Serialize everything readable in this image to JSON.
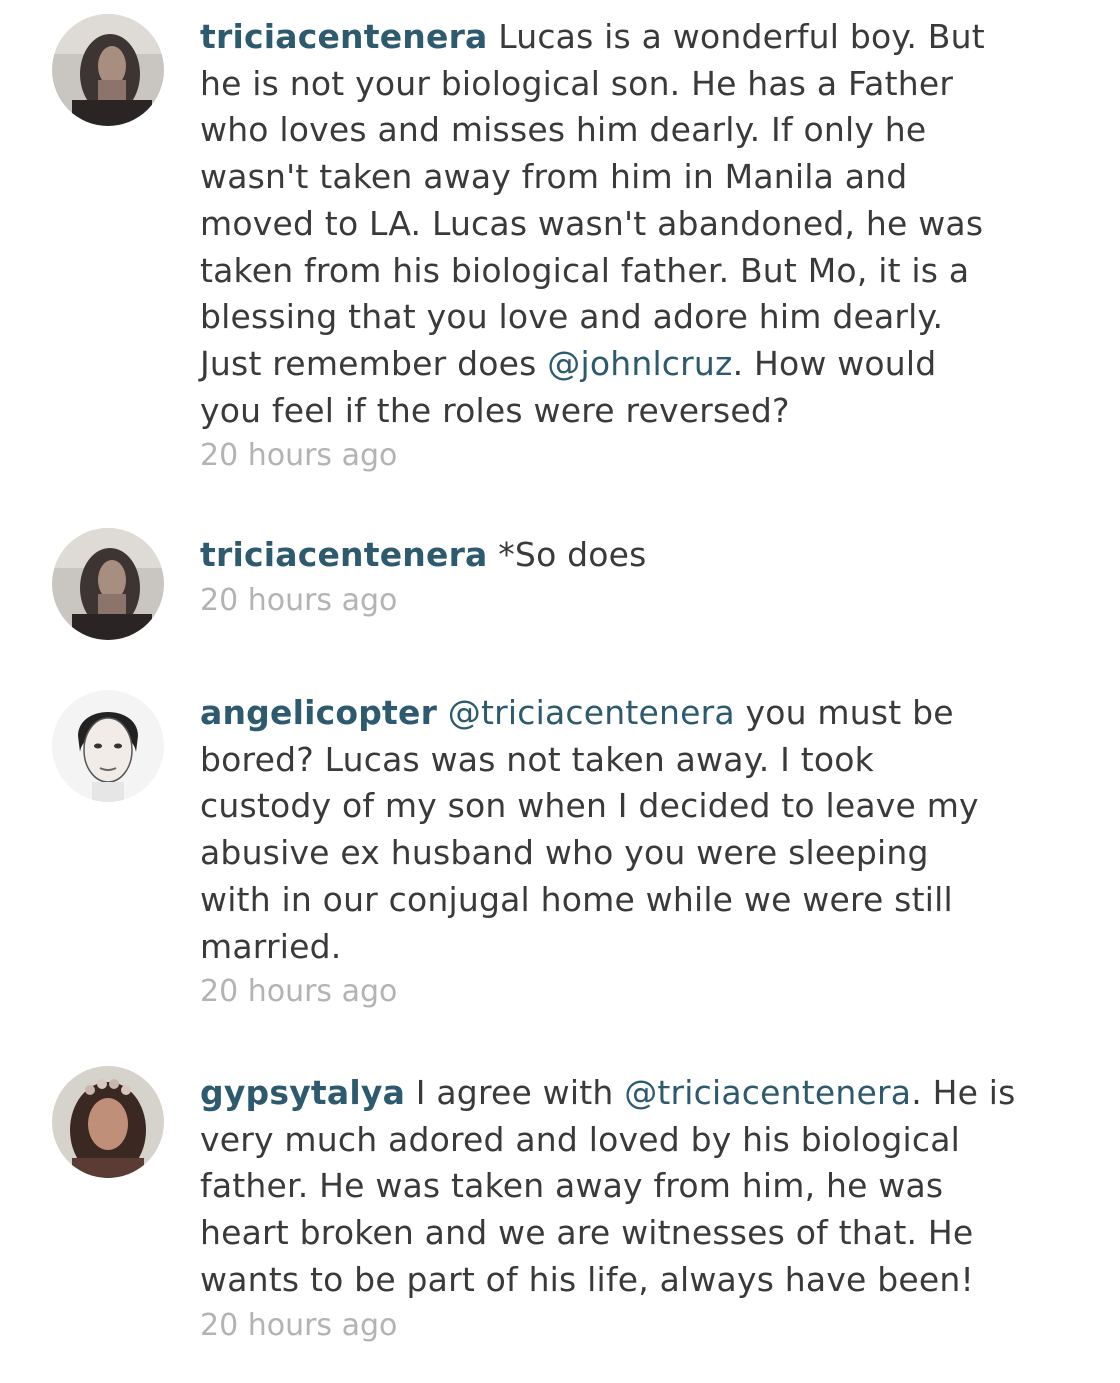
{
  "comments": [
    {
      "username": "triciacentenera",
      "lines": [
        [
          {
            "t": "Lucas is a wonderful boy. But"
          }
        ],
        [
          {
            "t": "he is not your biological son. He has a Father"
          }
        ],
        [
          {
            "t": "who loves and misses him dearly. If only he"
          }
        ],
        [
          {
            "t": "wasn't taken away from him in Manila and"
          }
        ],
        [
          {
            "t": "moved to LA. Lucas wasn't abandoned, he was"
          }
        ],
        [
          {
            "t": "taken from his biological father. But Mo, it is a"
          }
        ],
        [
          {
            "t": "blessing that you love and adore him dearly."
          }
        ],
        [
          {
            "t": "Just remember does "
          },
          {
            "t": "@johnlcruz",
            "mention": true
          },
          {
            "t": ". How would"
          }
        ],
        [
          {
            "t": "you feel if the roles were reversed?"
          }
        ]
      ],
      "time": "20 hours ago"
    },
    {
      "username": "triciacentenera",
      "lines": [
        [
          {
            "t": "*So does"
          }
        ]
      ],
      "time": "20 hours ago"
    },
    {
      "username": "angelicopter",
      "lines": [
        [
          {
            "t": "@triciacentenera",
            "mention": true
          },
          {
            "t": " you must be"
          }
        ],
        [
          {
            "t": "bored? Lucas was not taken away. I took"
          }
        ],
        [
          {
            "t": "custody of my son when I decided to leave my"
          }
        ],
        [
          {
            "t": "abusive ex husband who you were sleeping"
          }
        ],
        [
          {
            "t": "with in our conjugal home while we were still"
          }
        ],
        [
          {
            "t": "married."
          }
        ]
      ],
      "time": "20 hours ago"
    },
    {
      "username": "gypsytalya",
      "lines": [
        [
          {
            "t": "I agree with "
          },
          {
            "t": "@triciacentenera",
            "mention": true
          },
          {
            "t": ". He is"
          }
        ],
        [
          {
            "t": "very much adored and loved by his biological"
          }
        ],
        [
          {
            "t": "father. He was taken away from him, he was"
          }
        ],
        [
          {
            "t": "heart broken and we are witnesses of that. He"
          }
        ],
        [
          {
            "t": "wants to be part of his life, always have been!"
          }
        ]
      ],
      "time": "20 hours ago"
    }
  ],
  "colors": {
    "username": "#2d5a6e",
    "text": "#3a3a3a",
    "timestamp": "#b3b3b3"
  },
  "icons": {
    "c1": "triciacentenera-avatar",
    "c2": "triciacentenera-avatar",
    "c3": "angelicopter-avatar",
    "c4": "gypsytalya-avatar"
  }
}
